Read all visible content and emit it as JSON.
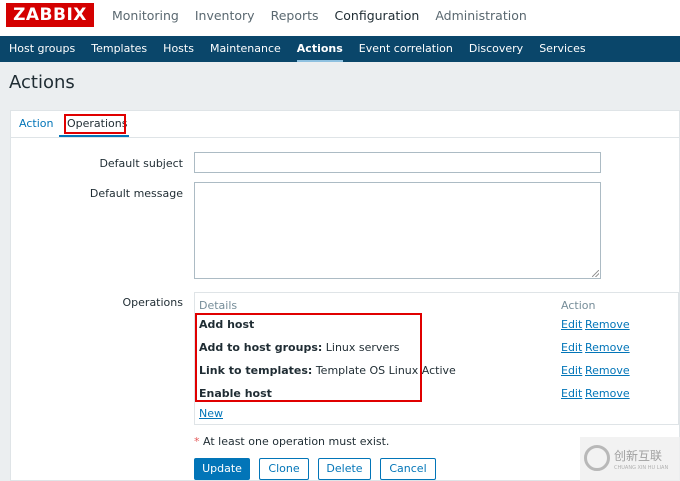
{
  "app": {
    "logo": "ZABBIX"
  },
  "main_nav": [
    "Monitoring",
    "Inventory",
    "Reports",
    "Configuration",
    "Administration"
  ],
  "main_nav_active": "Configuration",
  "sub_nav": [
    "Host groups",
    "Templates",
    "Hosts",
    "Maintenance",
    "Actions",
    "Event correlation",
    "Discovery",
    "Services"
  ],
  "sub_nav_active": "Actions",
  "page": {
    "title": "Actions"
  },
  "tabs": {
    "action": "Action",
    "operations": "Operations"
  },
  "form": {
    "default_subject_label": "Default subject",
    "default_subject_value": "",
    "default_message_label": "Default message",
    "default_message_value": "",
    "operations_label": "Operations"
  },
  "operations": {
    "col_details": "Details",
    "col_action": "Action",
    "rows": [
      {
        "bold": "Add host",
        "rest": ""
      },
      {
        "bold": "Add to host groups:",
        "rest": " Linux servers"
      },
      {
        "bold": "Link to templates:",
        "rest": " Template OS Linux Active"
      },
      {
        "bold": "Enable host",
        "rest": ""
      }
    ],
    "edit_label": "Edit",
    "remove_label": "Remove",
    "new_label": "New"
  },
  "note": {
    "star": "*",
    "text": " At least one operation must exist."
  },
  "buttons": {
    "update": "Update",
    "clone": "Clone",
    "delete": "Delete",
    "cancel": "Cancel"
  },
  "watermark": {
    "text": "创新互联",
    "sub": "CHUANG XIN HU LIAN"
  },
  "colors": {
    "brand_red": "#d40000",
    "nav_blue": "#0a466a",
    "link_blue": "#0275b8",
    "highlight_red": "#e00000"
  }
}
